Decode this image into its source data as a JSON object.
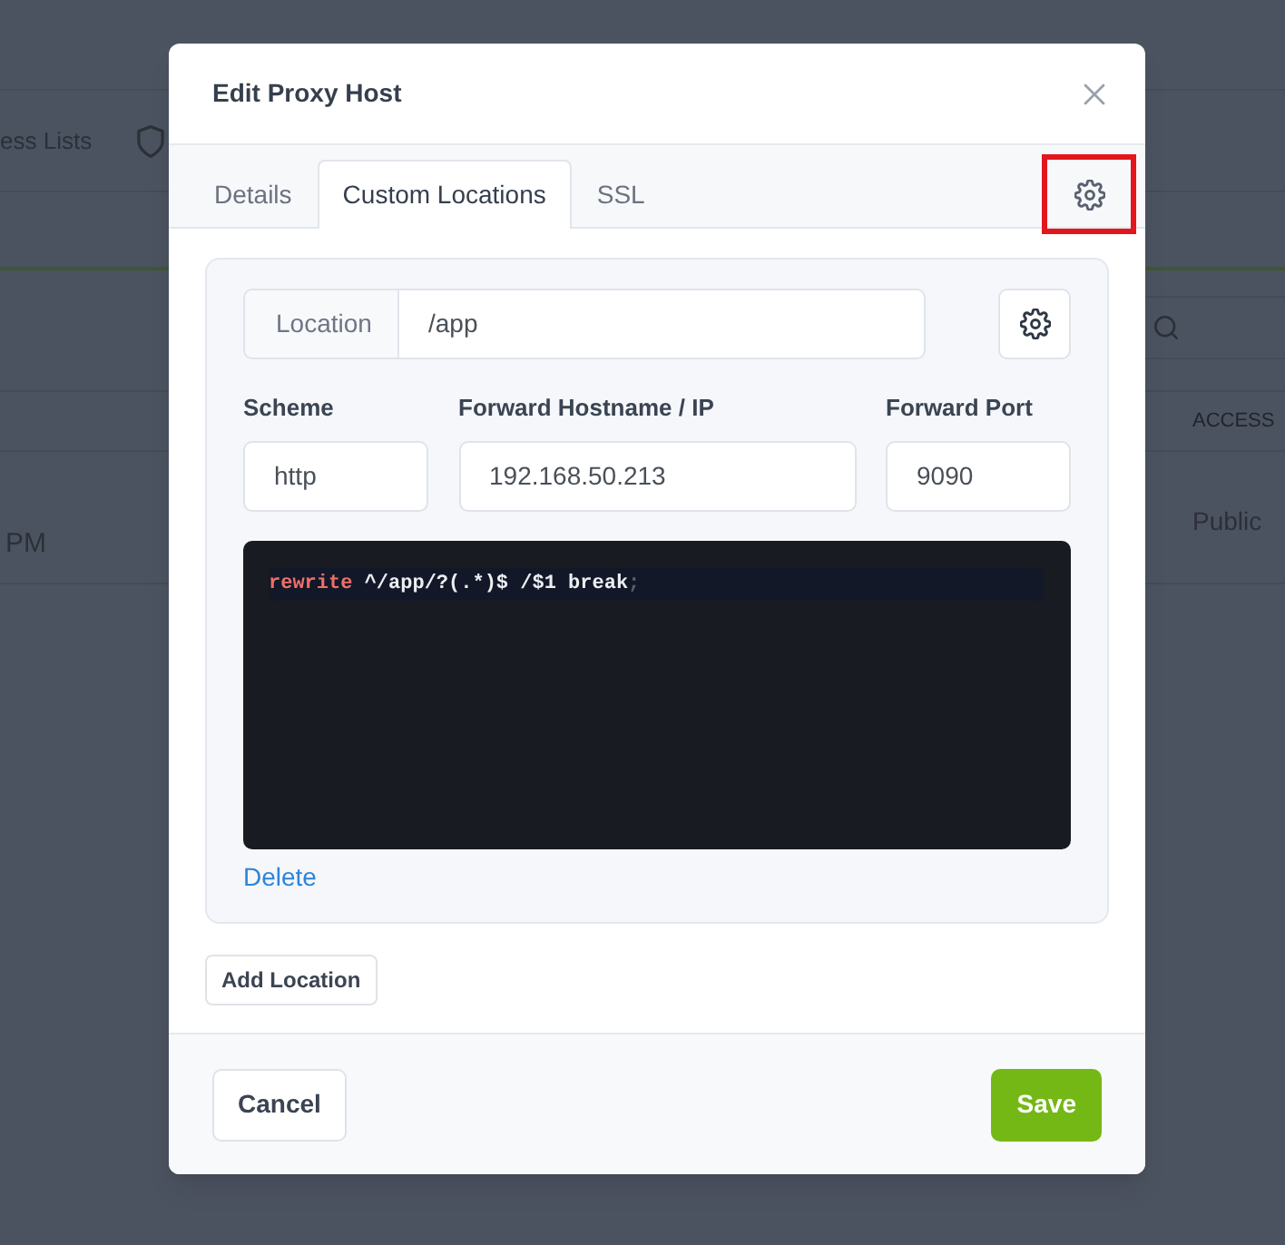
{
  "backdrop": {
    "nav_item": "ess Lists",
    "table_header": "ACCESS",
    "row": [
      "PM",
      "Public"
    ]
  },
  "dialog": {
    "title": "Edit Proxy Host",
    "tabs": [
      {
        "label": "Details",
        "selected": false
      },
      {
        "label": "Custom Locations",
        "selected": true
      },
      {
        "label": "SSL",
        "selected": false
      }
    ],
    "tab_settings": {
      "highlighted": true
    },
    "locations": [
      {
        "location_label": "Location",
        "path": "/app",
        "fields": [
          {
            "label": "Scheme",
            "value": "http"
          },
          {
            "label": "Forward Hostname / IP",
            "value": "192.168.50.213"
          },
          {
            "label": "Forward Port",
            "value": "9090"
          }
        ],
        "lines": [
          {
            "active": true,
            "tokens": [
              {
                "kind": "keyword",
                "text": "rewrite"
              },
              {
                "kind": "plain",
                "text": " ^/app/?(.*)$ /$1 break"
              },
              {
                "kind": "punctuation",
                "text": ";"
              }
            ]
          }
        ],
        "delete": "Delete"
      }
    ],
    "add_location": "Add Location",
    "buttons": [
      {
        "label": "Cancel",
        "kind": "cancel"
      },
      {
        "label": "Save",
        "kind": "save"
      }
    ]
  }
}
